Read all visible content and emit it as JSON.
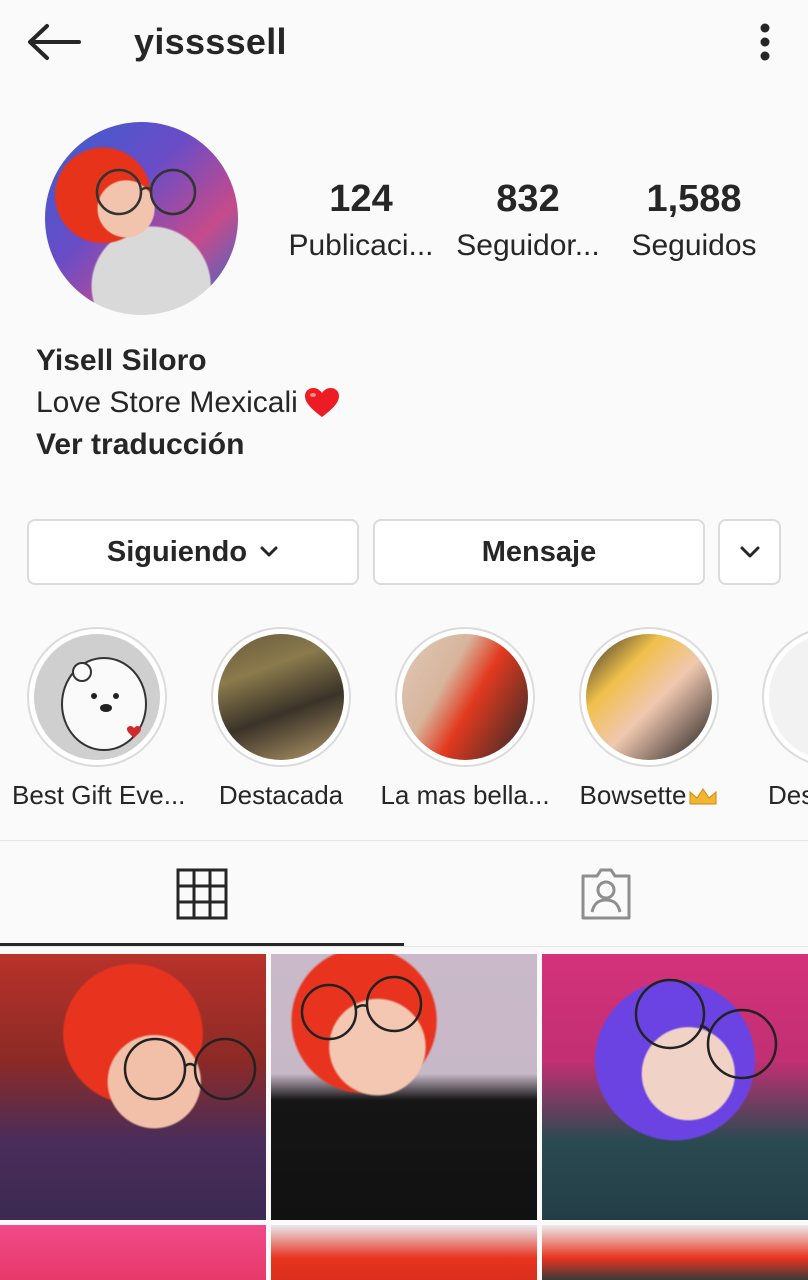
{
  "header": {
    "username": "yissssell",
    "back_icon": "arrow-left-icon",
    "more_icon": "more-vertical-icon"
  },
  "profile": {
    "stats": [
      {
        "value": "124",
        "label": "Publicaci..."
      },
      {
        "value": "832",
        "label": "Seguidor..."
      },
      {
        "value": "1,588",
        "label": "Seguidos"
      }
    ],
    "name": "Yisell Siloro",
    "bio": "Love Store Mexicali",
    "bio_emoji": "heart-icon",
    "translate_link": "Ver traducción"
  },
  "actions": {
    "following_label": "Siguiendo",
    "message_label": "Mensaje"
  },
  "highlights": [
    {
      "label": "Best Gift Eve..."
    },
    {
      "label": "Destacada"
    },
    {
      "label": "La mas bella..."
    },
    {
      "label": "Bowsette"
    },
    {
      "label": "Des"
    }
  ],
  "tabs": [
    {
      "icon": "grid-icon",
      "active": true
    },
    {
      "icon": "tagged-user-icon",
      "active": false
    }
  ],
  "colors": {
    "text": "#262626",
    "border": "#dbdbdb",
    "background": "#fafafa",
    "heart": "#ed1c24"
  }
}
